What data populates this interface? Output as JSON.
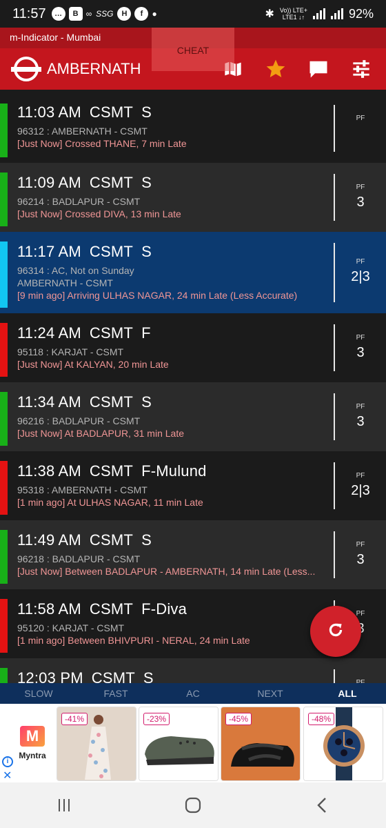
{
  "status_bar": {
    "time": "11:57",
    "icons": [
      "chat-icon",
      "b-icon",
      "infinity-icon",
      "ssg-text",
      "h-icon",
      "facebook-icon",
      "dot-icon",
      "bluetooth-icon",
      "signal-icon",
      "signal-icon",
      "battery-icon"
    ],
    "ssg": "SSG",
    "network_top": "Vo)) LTE+",
    "network_bottom": "LTE1 ↓↑",
    "battery": "92%"
  },
  "title_strip": "m-Indicator - Mumbai",
  "overlay_label": "CHEAT",
  "app_bar": {
    "station": "AMBERNATH",
    "actions": [
      "map-icon",
      "star-icon",
      "chat-bubble-icon",
      "filter-sliders-icon"
    ],
    "colors": {
      "primary": "#c4161e",
      "star": "#f39c12"
    }
  },
  "trains": [
    {
      "time": "11:03 AM",
      "dest": "CSMT",
      "kind": "S",
      "line1": "96312 : AMBERNATH - CSMT",
      "line2": "",
      "status": "[Just Now] Crossed THANE, 7 min Late",
      "pf_label": "PF",
      "pf": "",
      "bar": "green",
      "bg": "dark"
    },
    {
      "time": "11:09 AM",
      "dest": "CSMT",
      "kind": "S",
      "line1": "96214 : BADLAPUR - CSMT",
      "line2": "",
      "status": "[Just Now] Crossed DIVA, 13 min Late",
      "pf_label": "PF",
      "pf": "3",
      "bar": "green",
      "bg": "mid"
    },
    {
      "time": "11:17 AM",
      "dest": "CSMT",
      "kind": "S",
      "line1": "96314 : AC, Not on Sunday",
      "line2": "AMBERNATH - CSMT",
      "status": "[9 min ago] Arriving ULHAS NAGAR, 24 min Late (Less Accurate)",
      "pf_label": "PF",
      "pf": "2|3",
      "bar": "cyan",
      "bg": "ac"
    },
    {
      "time": "11:24 AM",
      "dest": "CSMT",
      "kind": "F",
      "line1": "95118 : KARJAT - CSMT",
      "line2": "",
      "status": "[Just Now] At KALYAN, 20 min Late",
      "pf_label": "PF",
      "pf": "3",
      "bar": "red",
      "bg": "dark"
    },
    {
      "time": "11:34 AM",
      "dest": "CSMT",
      "kind": "S",
      "line1": "96216 : BADLAPUR - CSMT",
      "line2": "",
      "status": "[Just Now] At BADLAPUR, 31 min Late",
      "pf_label": "PF",
      "pf": "3",
      "bar": "green",
      "bg": "mid"
    },
    {
      "time": "11:38 AM",
      "dest": "CSMT",
      "kind": "F-Mulund",
      "line1": "95318 : AMBERNATH - CSMT",
      "line2": "",
      "status": "[1 min ago] At ULHAS NAGAR, 11 min Late",
      "pf_label": "PF",
      "pf": "2|3",
      "bar": "red",
      "bg": "dark"
    },
    {
      "time": "11:49 AM",
      "dest": "CSMT",
      "kind": "S",
      "line1": "96218 : BADLAPUR - CSMT",
      "line2": "",
      "status": "[Just Now] Between BADLAPUR - AMBERNATH, 14 min Late (Less...",
      "pf_label": "PF",
      "pf": "3",
      "bar": "green",
      "bg": "mid"
    },
    {
      "time": "11:58 AM",
      "dest": "CSMT",
      "kind": "F-Diva",
      "line1": "95120 : KARJAT - CSMT",
      "line2": "",
      "status": "[1 min ago] Between BHIVPURI - NERAL, 24 min Late",
      "pf_label": "PF",
      "pf": "3",
      "bar": "red",
      "bg": "dark"
    },
    {
      "time": "12:03 PM",
      "dest": "CSMT",
      "kind": "S",
      "line1": "",
      "line2": "",
      "status": "",
      "pf_label": "PF",
      "pf": "",
      "bar": "green",
      "bg": "mid"
    }
  ],
  "fab": {
    "icon": "refresh-icon"
  },
  "tabs": [
    {
      "label": "SLOW",
      "active": false
    },
    {
      "label": "FAST",
      "active": false
    },
    {
      "label": "AC",
      "active": false
    },
    {
      "label": "NEXT",
      "active": false
    },
    {
      "label": "ALL",
      "active": true
    }
  ],
  "ad": {
    "brand": "Myntra",
    "products": [
      {
        "discount": "-41%",
        "item": "floral-dress"
      },
      {
        "discount": "-23%",
        "item": "clog-shoe"
      },
      {
        "discount": "-45%",
        "item": "slip-on-shoe"
      },
      {
        "discount": "-48%",
        "item": "wrist-watch"
      }
    ]
  },
  "nav": [
    "recents-icon",
    "home-icon",
    "back-icon"
  ]
}
